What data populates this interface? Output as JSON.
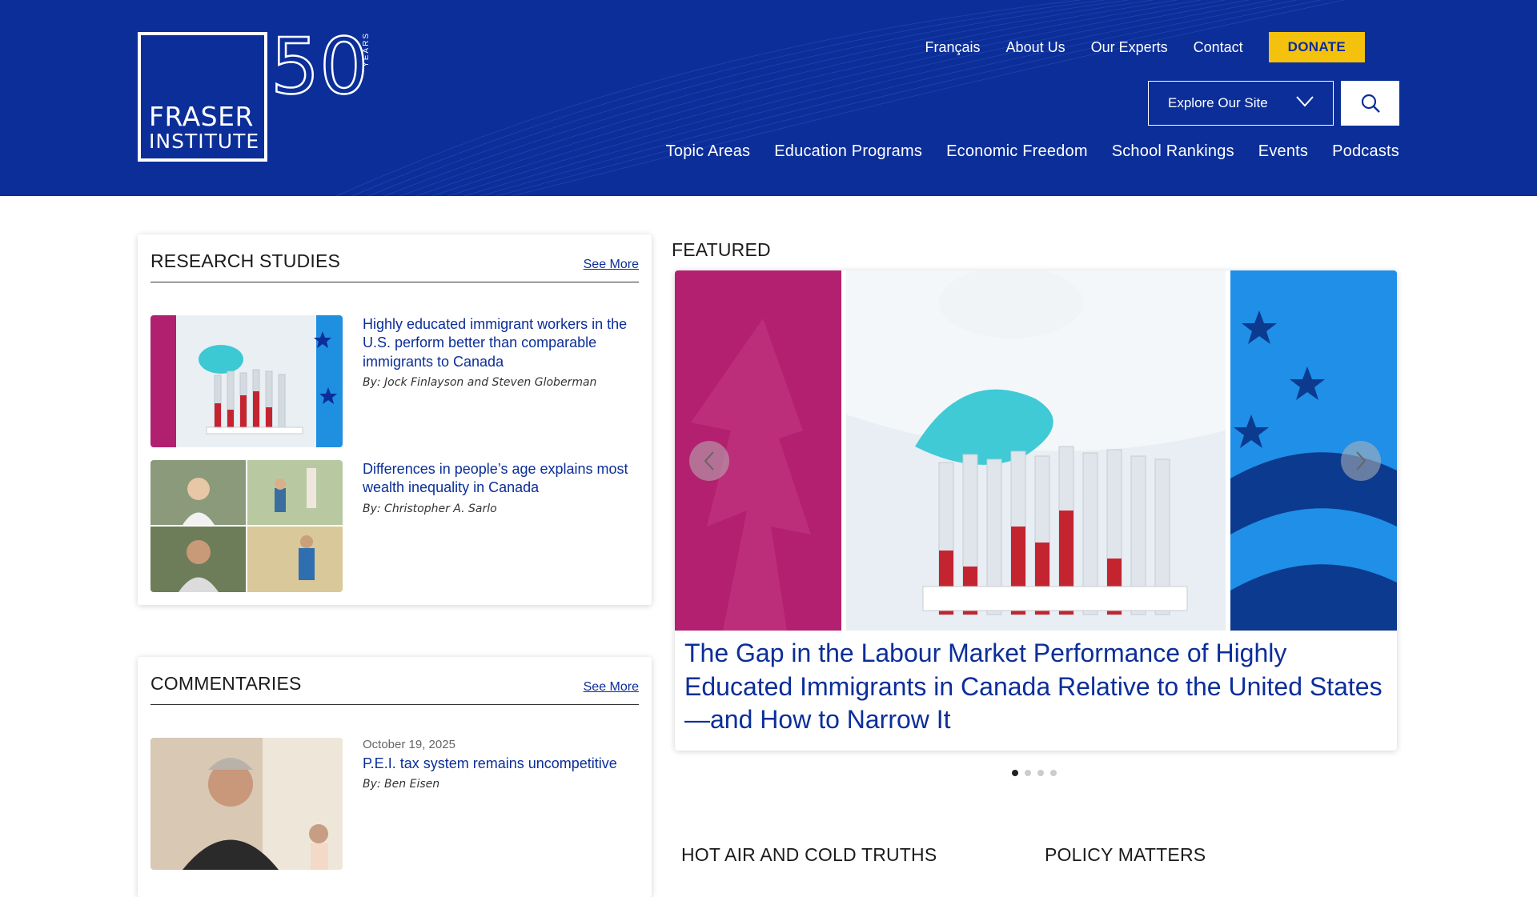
{
  "brand": {
    "logo_line1": "FRASER",
    "logo_line2": "INSTITUTE",
    "anniversary": "50",
    "anniversary_word": "YEARS",
    "primary_color": "#0b2e99",
    "donate_color": "#f4c20d"
  },
  "util_nav": {
    "francais": "Français",
    "about": "About Us",
    "experts": "Our Experts",
    "contact": "Contact",
    "donate": "DONATE"
  },
  "explore": {
    "label": "Explore Our Site",
    "icon": "chevron-down-icon"
  },
  "search": {
    "icon": "search-icon"
  },
  "main_nav": [
    "Topic Areas",
    "Education Programs",
    "Economic Freedom",
    "School Rankings",
    "Events",
    "Podcasts"
  ],
  "research": {
    "title": "RESEARCH STUDIES",
    "see_more": "See More",
    "items": [
      {
        "title": "Highly educated immigrant workers in the U.S. perform better than comparable immigrants to Canada",
        "by": "By: Jock Finlayson and Steven Globerman"
      },
      {
        "title": "Differences in people’s age explains most wealth inequality in Canada",
        "by": "By: Christopher A. Sarlo"
      }
    ]
  },
  "commentaries": {
    "title": "COMMENTARIES",
    "see_more": "See More",
    "items": [
      {
        "date": "October 19, 2025",
        "title": "P.E.I. tax system remains uncompetitive",
        "by": "By: Ben Eisen"
      }
    ]
  },
  "featured": {
    "label": "FEATURED",
    "title": "The Gap in the Labour Market Performance of Highly Educated Immigrants in Canada Relative to the United States—and How to Narrow It",
    "slide_count": 4,
    "active_slide": 1
  },
  "bottom_sections": {
    "left": "HOT AIR AND COLD TRUTHS",
    "right": "POLICY MATTERS"
  }
}
